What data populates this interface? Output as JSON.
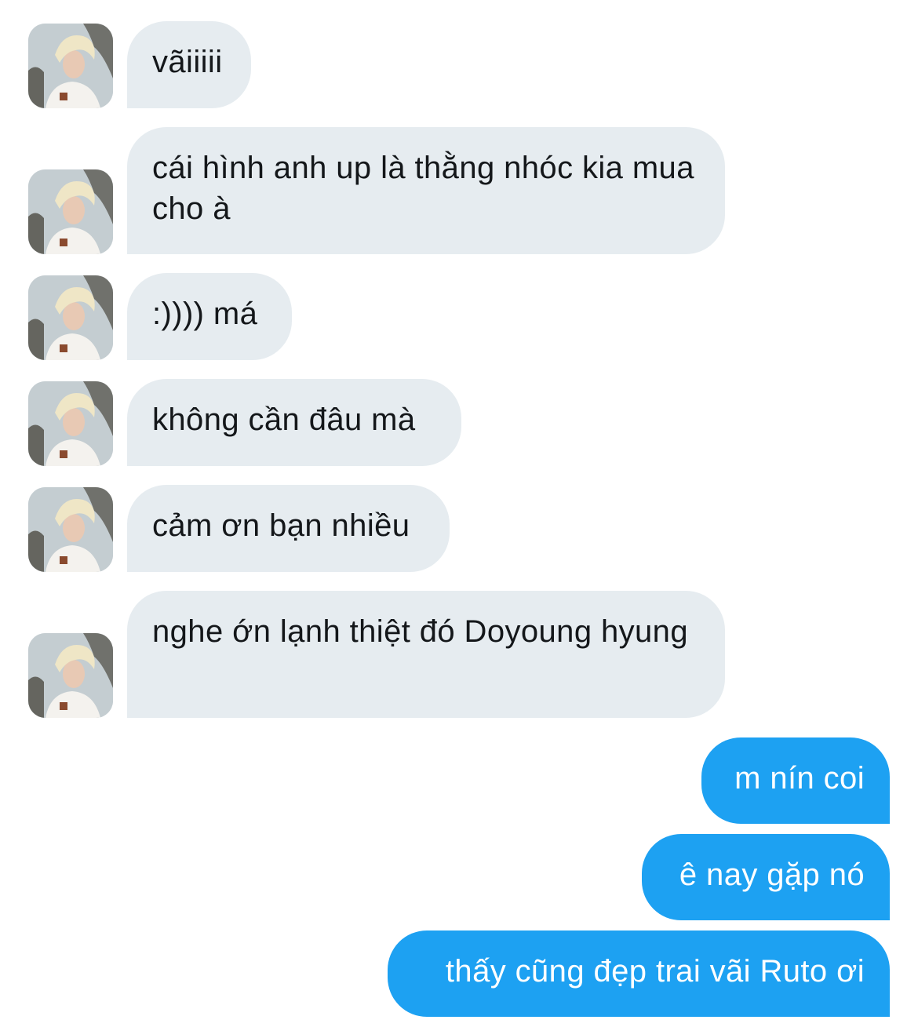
{
  "conversation": {
    "messages": [
      {
        "direction": "incoming",
        "text": "vãiiiii",
        "avatar": "user-avatar-photo"
      },
      {
        "direction": "incoming",
        "text": "cái hình anh up là thằng nhóc kia mua cho à",
        "avatar": "user-avatar-photo"
      },
      {
        "direction": "incoming",
        "text": ":)))) má",
        "avatar": "user-avatar-photo"
      },
      {
        "direction": "incoming",
        "text": "không cần đâu mà",
        "avatar": "user-avatar-photo"
      },
      {
        "direction": "incoming",
        "text": "cảm ơn bạn nhiều",
        "avatar": "user-avatar-photo"
      },
      {
        "direction": "incoming",
        "text": "nghe ớn lạnh thiệt đó Doyoung hyung",
        "avatar": "user-avatar-photo"
      },
      {
        "direction": "outgoing",
        "text": "m nín coi"
      },
      {
        "direction": "outgoing",
        "text": "ê nay gặp nó"
      },
      {
        "direction": "outgoing",
        "text": "thấy cũng đẹp trai vãi Ruto ơi"
      }
    ]
  },
  "colors": {
    "incoming_bubble": "#e6ecf0",
    "incoming_text": "#14171a",
    "outgoing_bubble": "#1da1f2",
    "outgoing_text": "#ffffff"
  }
}
